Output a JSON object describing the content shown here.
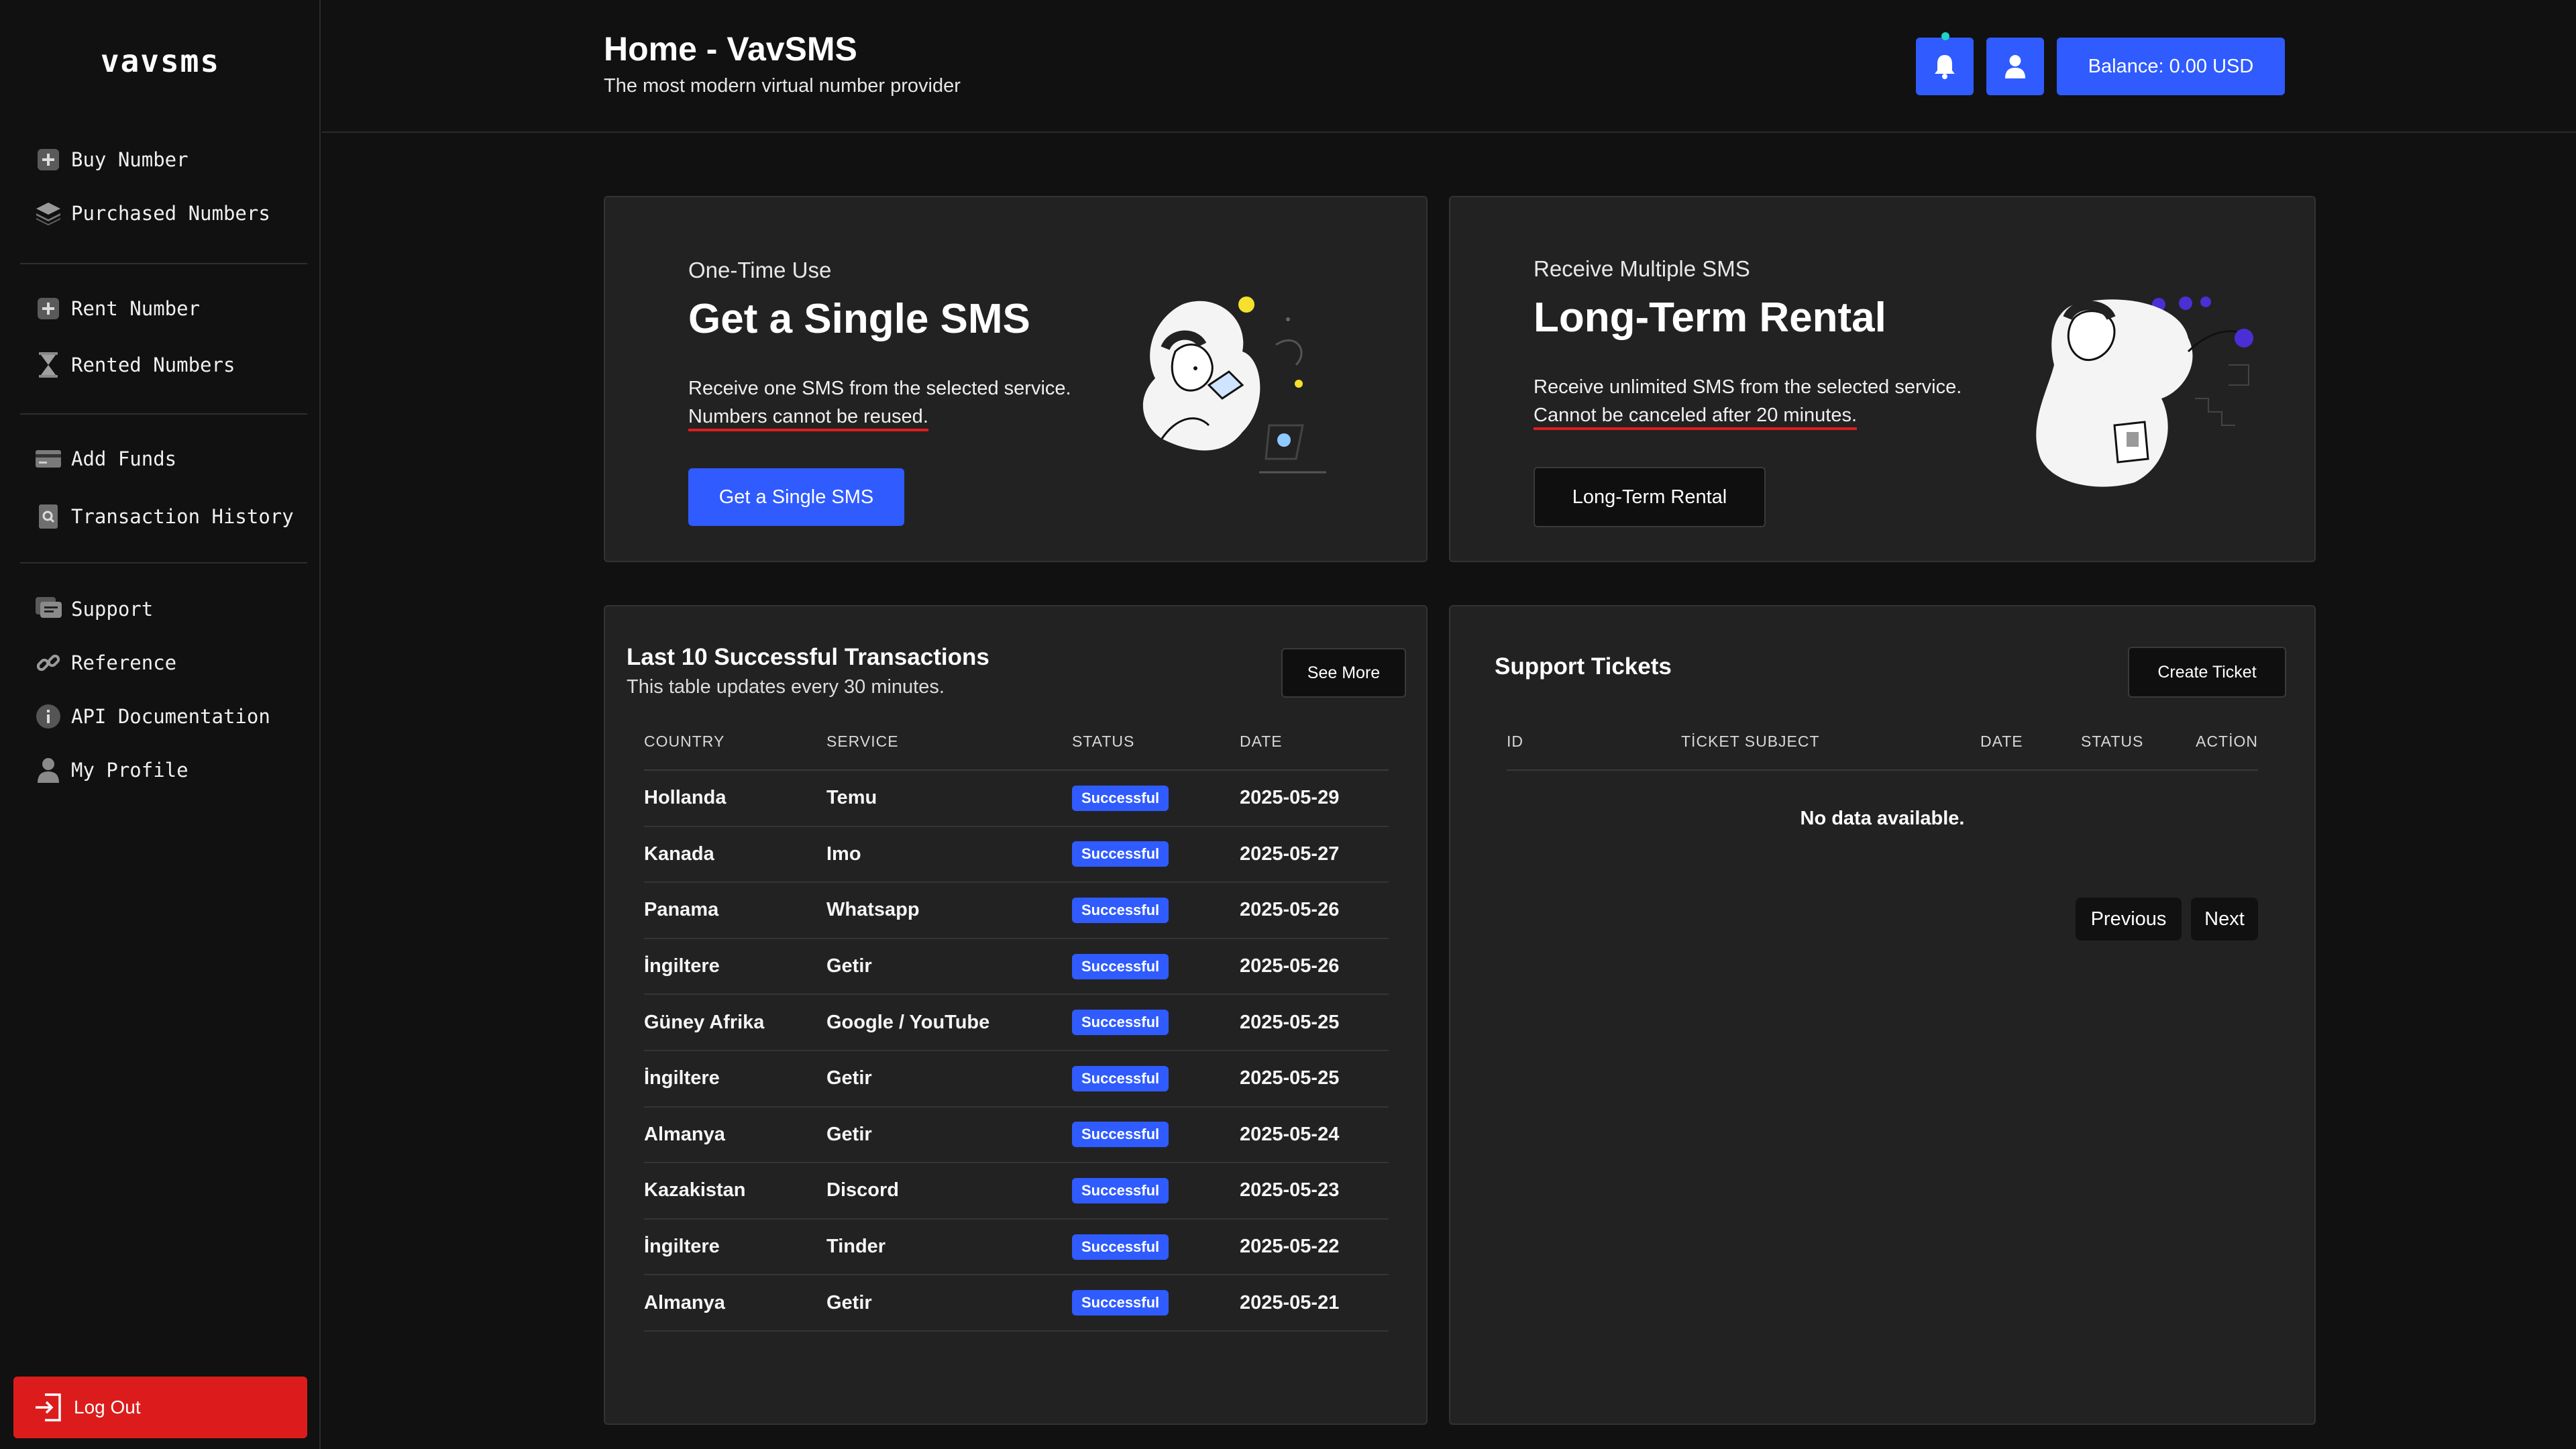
{
  "brand": {
    "logo": "vavsms"
  },
  "sidebar": {
    "groups": [
      [
        {
          "label": "Buy Number",
          "icon": "plus-square-icon"
        },
        {
          "label": "Purchased Numbers",
          "icon": "layers-icon"
        }
      ],
      [
        {
          "label": "Rent Number",
          "icon": "plus-square-icon"
        },
        {
          "label": "Rented Numbers",
          "icon": "hourglass-icon"
        }
      ],
      [
        {
          "label": "Add Funds",
          "icon": "credit-card-icon"
        },
        {
          "label": "Transaction History",
          "icon": "search-document-icon"
        }
      ],
      [
        {
          "label": "Support",
          "icon": "chat-icon"
        },
        {
          "label": "Reference",
          "icon": "link-icon"
        },
        {
          "label": "API Documentation",
          "icon": "info-icon"
        },
        {
          "label": "My Profile",
          "icon": "user-icon"
        }
      ]
    ],
    "logout": "Log Out"
  },
  "header": {
    "title": "Home - VavSMS",
    "subtitle": "The most modern virtual number provider",
    "balance": "Balance: 0.00 USD"
  },
  "promo_single": {
    "kicker": "One-Time Use",
    "title": "Get a Single SMS",
    "desc": "Receive one SMS from the selected service.",
    "warning": "Numbers cannot be reused.",
    "button": "Get a Single SMS"
  },
  "promo_rental": {
    "kicker": "Receive Multiple SMS",
    "title": "Long-Term Rental",
    "desc": "Receive unlimited SMS from the selected service.",
    "warning": "Cannot be canceled after 20 minutes.",
    "button": "Long-Term Rental"
  },
  "transactions": {
    "title": "Last 10 Successful Transactions",
    "subtitle": "This table updates every 30 minutes.",
    "see_more": "See More",
    "columns": [
      "COUNTRY",
      "SERVICE",
      "STATUS",
      "DATE"
    ],
    "rows": [
      {
        "country": "Hollanda",
        "service": "Temu",
        "status": "Successful",
        "date": "2025-05-29"
      },
      {
        "country": "Kanada",
        "service": "Imo",
        "status": "Successful",
        "date": "2025-05-27"
      },
      {
        "country": "Panama",
        "service": "Whatsapp",
        "status": "Successful",
        "date": "2025-05-26"
      },
      {
        "country": "İngiltere",
        "service": "Getir",
        "status": "Successful",
        "date": "2025-05-26"
      },
      {
        "country": "Güney Afrika",
        "service": "Google / YouTube",
        "status": "Successful",
        "date": "2025-05-25"
      },
      {
        "country": "İngiltere",
        "service": "Getir",
        "status": "Successful",
        "date": "2025-05-25"
      },
      {
        "country": "Almanya",
        "service": "Getir",
        "status": "Successful",
        "date": "2025-05-24"
      },
      {
        "country": "Kazakistan",
        "service": "Discord",
        "status": "Successful",
        "date": "2025-05-23"
      },
      {
        "country": "İngiltere",
        "service": "Tinder",
        "status": "Successful",
        "date": "2025-05-22"
      },
      {
        "country": "Almanya",
        "service": "Getir",
        "status": "Successful",
        "date": "2025-05-21"
      }
    ]
  },
  "tickets": {
    "title": "Support Tickets",
    "create": "Create Ticket",
    "columns": [
      "ID",
      "TİCKET SUBJECT",
      "DATE",
      "STATUS",
      "ACTİON"
    ],
    "empty": "No data available.",
    "prev": "Previous",
    "next": "Next"
  },
  "colors": {
    "accent": "#2f5bff",
    "danger": "#dc1c1c",
    "background": "#111111",
    "card": "#222222"
  }
}
